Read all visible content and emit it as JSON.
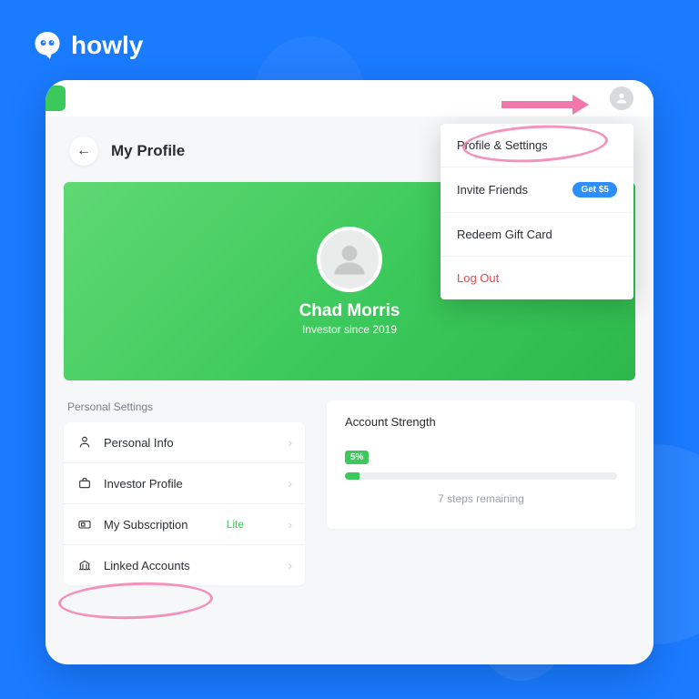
{
  "brand": {
    "name": "howly"
  },
  "header": {
    "page_title": "My Profile"
  },
  "hero": {
    "user_name": "Chad Morris",
    "subtitle": "Investor since 2019"
  },
  "dropdown": {
    "profile_settings": "Profile & Settings",
    "invite_friends": "Invite Friends",
    "invite_badge": "Get $5",
    "redeem": "Redeem Gift Card",
    "logout": "Log Out"
  },
  "settings": {
    "section_label": "Personal Settings",
    "items": [
      {
        "label": "Personal Info"
      },
      {
        "label": "Investor Profile"
      },
      {
        "label": "My Subscription",
        "tag": "Lite"
      },
      {
        "label": "Linked Accounts"
      }
    ]
  },
  "strength": {
    "title": "Account Strength",
    "percent_label": "5%",
    "remaining": "7 steps remaining"
  }
}
